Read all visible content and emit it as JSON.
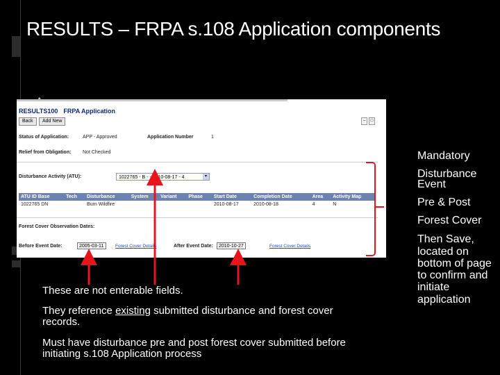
{
  "slide": {
    "title": "RESULTS – FRPA s.108 Application components"
  },
  "screenshot": {
    "header": {
      "app": "RESULTS100",
      "title": "FRPA Application"
    },
    "buttons": {
      "back": "Back",
      "add_new": "Add New"
    },
    "status_label": "Status of Application:",
    "status_value": "APP  -  Approved",
    "app_number_label": "Application Number",
    "app_number_value": "1",
    "relief_label": "Relief from Obligation:",
    "relief_value": "Not Checked",
    "disturbance_label": "Disturbance Activity (ATU):",
    "disturbance_select": "1022765 - B - - 2010-08-17 - 4",
    "table": {
      "headers": [
        "ATU ID Base",
        "Tech",
        "Disturbance",
        "System",
        "Variant",
        "Phase",
        "Start Date",
        "Completion Date",
        "Area",
        "Activity Map"
      ],
      "rows": [
        [
          "1022765 DN",
          "",
          "Burn Wildfire",
          "",
          "",
          "",
          "2010-08-17",
          "2010-08-18",
          "4",
          "N"
        ]
      ]
    },
    "forest_cover_label": "Forest Cover Observation Dates:",
    "before_label": "Before Event Date:",
    "before_value": "2005-03-11",
    "before_link": "Forest Cover Details",
    "after_label": "After Event Date:",
    "after_value": "2010-10-27",
    "after_link": "Forest Cover Details"
  },
  "side_notes": {
    "mandatory": "Mandatory",
    "disturbance_1": "Disturbance",
    "disturbance_2": "Event",
    "pre_post": "Pre & Post",
    "forest_cover": "Forest Cover",
    "then_save": [
      "Then Save,",
      "located on",
      "bottom of page",
      "to confirm and",
      "initiate",
      "application"
    ]
  },
  "captions": {
    "line1": "These are not enterable fields.",
    "line2_before": "They reference ",
    "line2_underlined": "existing",
    "line2_after": " submitted disturbance and forest cover",
    "line2_cont": "records.",
    "line3": "Must have disturbance pre and post forest cover submitted before",
    "line3_cont": "initiating s.108 Application process"
  },
  "colors": {
    "accent_red": "#e8141c",
    "table_header": "#6d82b0",
    "link_blue": "#1a4ec8"
  }
}
